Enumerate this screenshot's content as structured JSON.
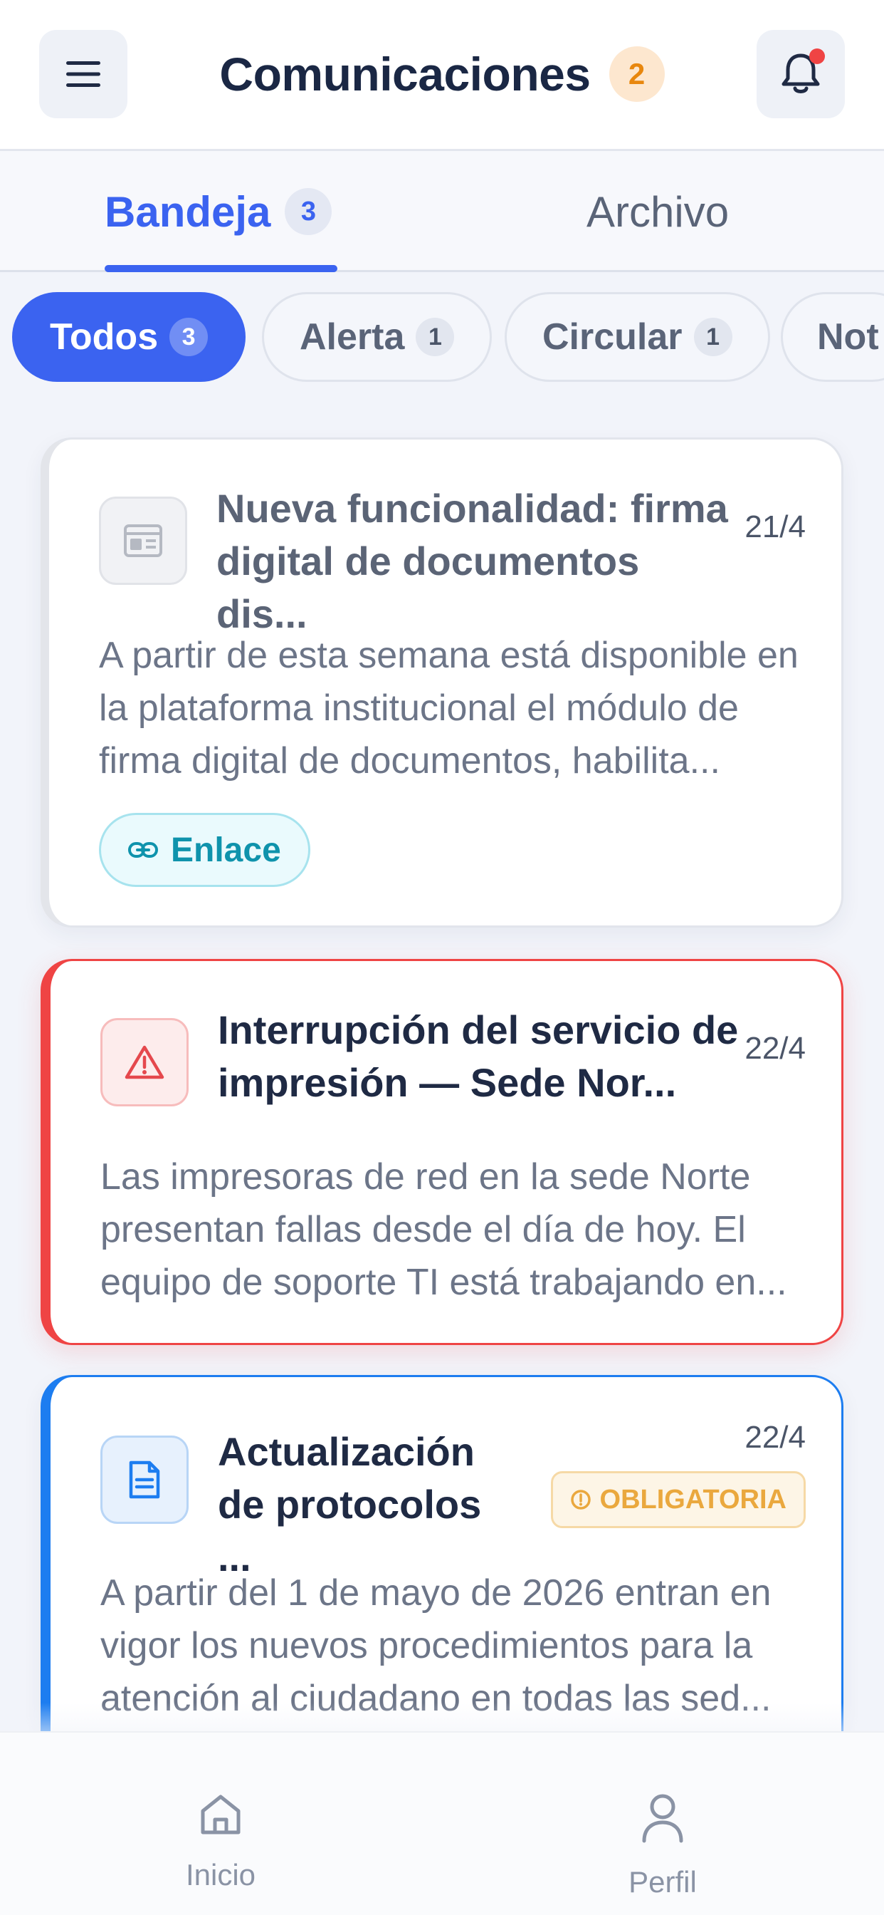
{
  "header": {
    "title": "Comunicaciones",
    "badge_count": "2",
    "menu_icon": "hamburger-menu-icon",
    "bell_icon": "bell-icon"
  },
  "tabs": [
    {
      "label": "Bandeja",
      "count": "3",
      "active": true
    },
    {
      "label": "Archivo",
      "active": false
    }
  ],
  "filters": [
    {
      "label": "Todos",
      "count": "3",
      "active": true
    },
    {
      "label": "Alerta",
      "count": "1",
      "active": false
    },
    {
      "label": "Circular",
      "count": "1",
      "active": false
    },
    {
      "label": "Not",
      "active": false
    }
  ],
  "cards": [
    {
      "title": "Nueva funcionalidad: firma digital de documentos dis...",
      "date": "21/4",
      "body": "A partir de esta semana está disponible en la plataforma institucional el módulo de firma digital de documentos, habilita...",
      "tag": "Enlace",
      "icon": "newspaper-icon"
    },
    {
      "title": "Interrupción del servicio de impresión — Sede Nor...",
      "date": "22/4",
      "body": "Las impresoras de red en la sede Norte presentan fallas desde el día de hoy. El equipo de soporte TI está trabajando en...",
      "icon": "warning-triangle-icon"
    },
    {
      "title": "Actualización de protocolos ...",
      "date": "22/4",
      "badge": "OBLIGATORIA",
      "body": "A partir del 1 de mayo de 2026 entran en vigor los nuevos procedimientos para la atención al ciudadano en todas las sed...",
      "icon": "document-icon"
    }
  ],
  "bottom_nav": [
    {
      "label": "Inicio",
      "icon": "home-icon"
    },
    {
      "label": "Perfil",
      "icon": "user-icon"
    }
  ],
  "colors": {
    "primary": "#3b63f0",
    "alert": "#ef4444",
    "info": "#1d7df0",
    "badge_orange": "#e8870e",
    "link_teal": "#0f93ac"
  }
}
